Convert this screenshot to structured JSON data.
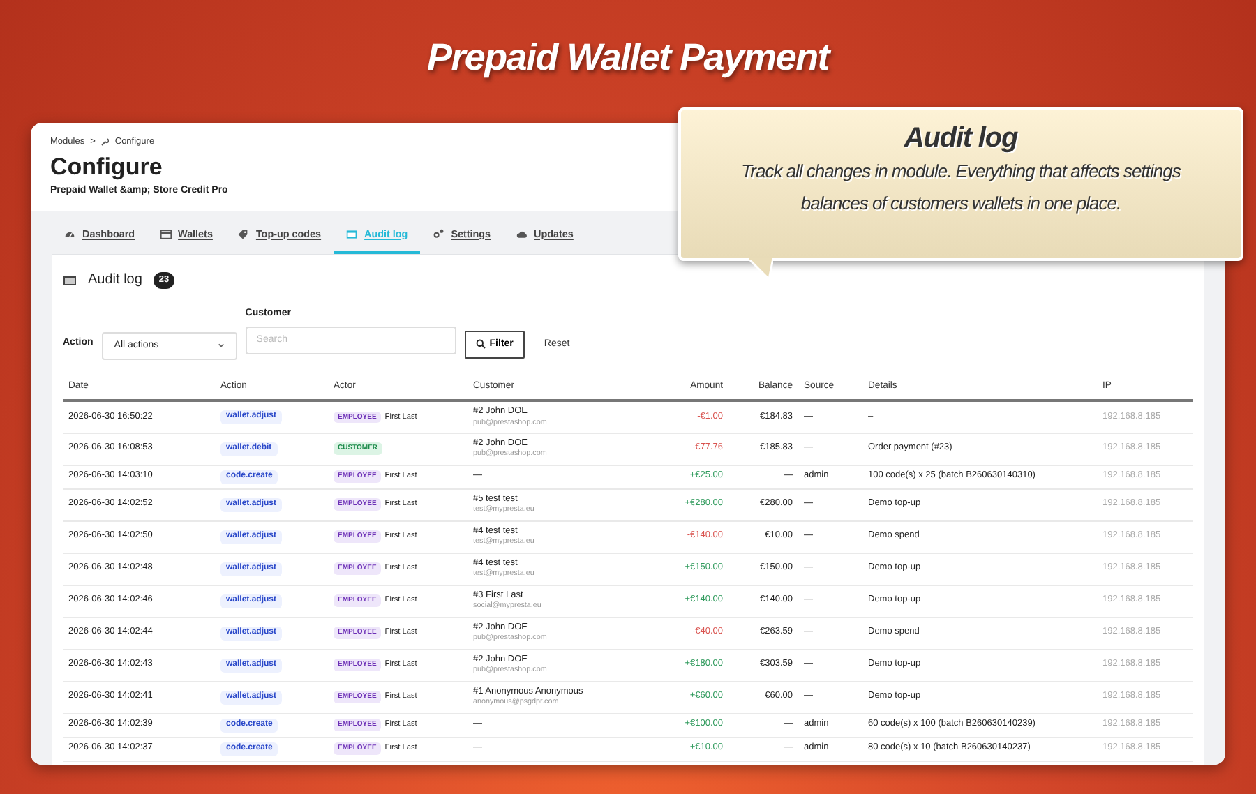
{
  "header": {
    "title": "Prepaid Wallet Payment"
  },
  "callout": {
    "title": "Audit log",
    "text": "Track all changes in module. Everything that affects settings balances of customers wallets in one place."
  },
  "breadcrumb": {
    "items": [
      "Modules",
      "Configure"
    ],
    "separator": ">"
  },
  "page": {
    "title": "Configure",
    "subtitle": "Prepaid Wallet &amp; Store Credit Pro"
  },
  "tabs": [
    {
      "label": "Dashboard",
      "selected": false
    },
    {
      "label": "Wallets",
      "selected": false
    },
    {
      "label": "Top-up codes",
      "selected": false
    },
    {
      "label": "Audit log",
      "selected": true
    },
    {
      "label": "Settings",
      "selected": false
    },
    {
      "label": "Updates",
      "selected": false
    }
  ],
  "card": {
    "title": "Audit log",
    "count": "23"
  },
  "filters": {
    "action_label": "Action",
    "action_value": "All actions",
    "customer_label": "Customer",
    "search_placeholder": "Search",
    "filter_button": "Filter",
    "reset_link": "Reset"
  },
  "table": {
    "columns": [
      "Date",
      "Action",
      "Actor",
      "Customer",
      "Amount",
      "Balance",
      "Source",
      "Details",
      "IP"
    ],
    "rows": [
      {
        "date": "2026-06-30 16:50:22",
        "action": "wallet.adjust",
        "actor": {
          "kind": "employee",
          "role": "EMPLOYEE",
          "name": "First Last"
        },
        "customer": "#2 John DOE",
        "email": "pub@prestashop.com",
        "amount": {
          "kind": "debit",
          "text": "-€1.00"
        },
        "balance": "€184.83",
        "source": "—",
        "details": "–",
        "ip": "192.168.8.185"
      },
      {
        "date": "2026-06-30 16:08:53",
        "action": "wallet.debit",
        "actor": {
          "kind": "customer",
          "role": "CUSTOMER"
        },
        "customer": "#2 John DOE",
        "email": "pub@prestashop.com",
        "amount": {
          "kind": "debit",
          "text": "-€77.76"
        },
        "balance": "€185.83",
        "source": "—",
        "details": "Order payment (#23)",
        "ip": "192.168.8.185"
      },
      {
        "date": "2026-06-30 14:03:10",
        "action": "code.create",
        "actor": {
          "kind": "employee",
          "role": "EMPLOYEE",
          "name": "First Last"
        },
        "customer": "—",
        "amount": {
          "kind": "credit",
          "text": "+€25.00"
        },
        "balance": "—",
        "source": "admin",
        "details": "100 code(s) x 25 (batch B260630140310)",
        "ip": "192.168.8.185"
      },
      {
        "date": "2026-06-30 14:02:52",
        "action": "wallet.adjust",
        "actor": {
          "kind": "employee",
          "role": "EMPLOYEE",
          "name": "First Last"
        },
        "customer": "#5 test test",
        "email": "test@mypresta.eu",
        "amount": {
          "kind": "credit",
          "text": "+€280.00"
        },
        "balance": "€280.00",
        "source": "—",
        "details": "Demo top-up",
        "ip": "192.168.8.185"
      },
      {
        "date": "2026-06-30 14:02:50",
        "action": "wallet.adjust",
        "actor": {
          "kind": "employee",
          "role": "EMPLOYEE",
          "name": "First Last"
        },
        "customer": "#4 test test",
        "email": "test@mypresta.eu",
        "amount": {
          "kind": "debit",
          "text": "-€140.00"
        },
        "balance": "€10.00",
        "source": "—",
        "details": "Demo spend",
        "ip": "192.168.8.185"
      },
      {
        "date": "2026-06-30 14:02:48",
        "action": "wallet.adjust",
        "actor": {
          "kind": "employee",
          "role": "EMPLOYEE",
          "name": "First Last"
        },
        "customer": "#4 test test",
        "email": "test@mypresta.eu",
        "amount": {
          "kind": "credit",
          "text": "+€150.00"
        },
        "balance": "€150.00",
        "source": "—",
        "details": "Demo top-up",
        "ip": "192.168.8.185"
      },
      {
        "date": "2026-06-30 14:02:46",
        "action": "wallet.adjust",
        "actor": {
          "kind": "employee",
          "role": "EMPLOYEE",
          "name": "First Last"
        },
        "customer": "#3 First Last",
        "email": "social@mypresta.eu",
        "amount": {
          "kind": "credit",
          "text": "+€140.00"
        },
        "balance": "€140.00",
        "source": "—",
        "details": "Demo top-up",
        "ip": "192.168.8.185"
      },
      {
        "date": "2026-06-30 14:02:44",
        "action": "wallet.adjust",
        "actor": {
          "kind": "employee",
          "role": "EMPLOYEE",
          "name": "First Last"
        },
        "customer": "#2 John DOE",
        "email": "pub@prestashop.com",
        "amount": {
          "kind": "debit",
          "text": "-€40.00"
        },
        "balance": "€263.59",
        "source": "—",
        "details": "Demo spend",
        "ip": "192.168.8.185"
      },
      {
        "date": "2026-06-30 14:02:43",
        "action": "wallet.adjust",
        "actor": {
          "kind": "employee",
          "role": "EMPLOYEE",
          "name": "First Last"
        },
        "customer": "#2 John DOE",
        "email": "pub@prestashop.com",
        "amount": {
          "kind": "credit",
          "text": "+€180.00"
        },
        "balance": "€303.59",
        "source": "—",
        "details": "Demo top-up",
        "ip": "192.168.8.185"
      },
      {
        "date": "2026-06-30 14:02:41",
        "action": "wallet.adjust",
        "actor": {
          "kind": "employee",
          "role": "EMPLOYEE",
          "name": "First Last"
        },
        "customer": "#1 Anonymous Anonymous",
        "email": "anonymous@psgdpr.com",
        "amount": {
          "kind": "credit",
          "text": "+€60.00"
        },
        "balance": "€60.00",
        "source": "—",
        "details": "Demo top-up",
        "ip": "192.168.8.185"
      },
      {
        "date": "2026-06-30 14:02:39",
        "action": "code.create",
        "actor": {
          "kind": "employee",
          "role": "EMPLOYEE",
          "name": "First Last"
        },
        "customer": "—",
        "amount": {
          "kind": "credit",
          "text": "+€100.00"
        },
        "balance": "—",
        "source": "admin",
        "details": "60 code(s) x 100 (batch B260630140239)",
        "ip": "192.168.8.185"
      },
      {
        "date": "2026-06-30 14:02:37",
        "action": "code.create",
        "actor": {
          "kind": "employee",
          "role": "EMPLOYEE",
          "name": "First Last"
        },
        "customer": "—",
        "amount": {
          "kind": "credit",
          "text": "+€10.00"
        },
        "balance": "—",
        "source": "admin",
        "details": "80 code(s) x 10 (batch B260630140237)",
        "ip": "192.168.8.185"
      }
    ]
  }
}
